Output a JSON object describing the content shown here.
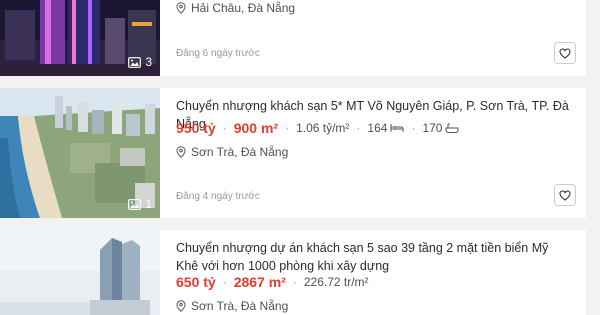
{
  "listings": [
    {
      "location": "Hải Châu, Đà Nẵng",
      "posted": "Đăng 6 ngày trước",
      "photo_count": "3"
    },
    {
      "title": "Chuyển nhượng khách sạn 5* MT Võ Nguyên Giáp, P. Sơn Trà, TP. Đà Nẵng",
      "price": "950 tỷ",
      "area": "900 m²",
      "price_per_m2": "1.06 tỷ/m²",
      "bedrooms": "164",
      "bathrooms": "170",
      "location": "Sơn Trà, Đà Nẵng",
      "posted": "Đăng 4 ngày trước",
      "photo_count": "1"
    },
    {
      "title": "Chuyển nhượng dự án khách sạn 5 sao 39 tầng 2 mặt tiền biển Mỹ Khê với hơn 1000 phòng khi xây dựng",
      "price": "650 tỷ",
      "area": "2867 m²",
      "price_per_m2": "226.72 tr/m²",
      "location": "Sơn Trà, Đà Nẵng"
    }
  ],
  "colors": {
    "price": "#e03c31",
    "text": "#2c2c2c",
    "muted": "#999999",
    "background": "#f2f2f2"
  },
  "icons": [
    "location-pin-icon",
    "image-icon",
    "heart-icon",
    "bed-icon",
    "bath-icon"
  ]
}
